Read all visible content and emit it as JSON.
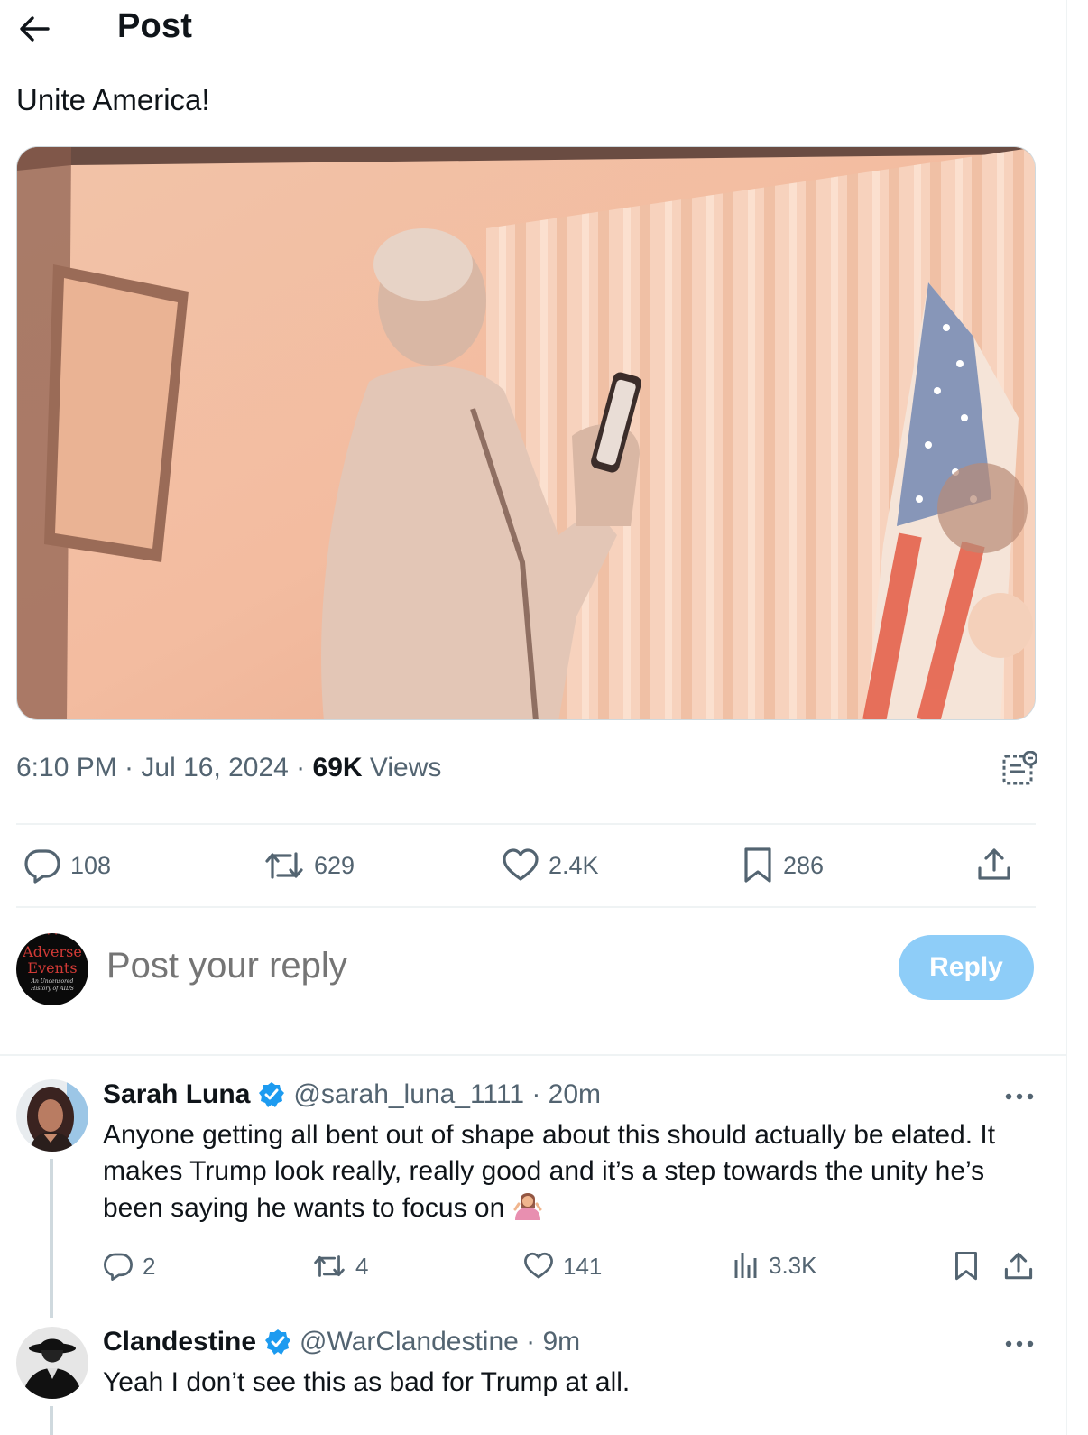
{
  "header": {
    "title": "Post"
  },
  "post": {
    "text": "Unite America!",
    "time": "6:10 PM · Jul 16, 2024 · ",
    "views_count": "69K",
    "views_label": " Views",
    "media": "video-still-man-holding-phone-flag",
    "stats": {
      "replies": "108",
      "reposts": "629",
      "likes": "2.4K",
      "bookmarks": "286"
    }
  },
  "composer": {
    "placeholder": "Post your reply",
    "reply_label": "Reply",
    "avatar_title": "Adverse Events",
    "avatar_sub": "An Uncensored History of AIDS"
  },
  "replies": [
    {
      "name": "Sarah Luna",
      "handle": "@sarah_luna_1111 · 20m",
      "text": "Anyone getting all bent out of shape about this should actually be elated. It makes Trump look really, really good and it’s a step towards the unity he’s been saying he wants to focus on",
      "replies": "2",
      "reposts": "4",
      "likes": "141",
      "views": "3.3K"
    },
    {
      "name": "Clandestine",
      "handle": "@WarClandestine · 9m",
      "text": "Yeah I don’t see this as bad for Trump at all."
    }
  ],
  "colors": {
    "text": "#0f1419",
    "muted": "#536471",
    "verified": "#1d9bf0",
    "reply_button": "#8ecdf8"
  }
}
